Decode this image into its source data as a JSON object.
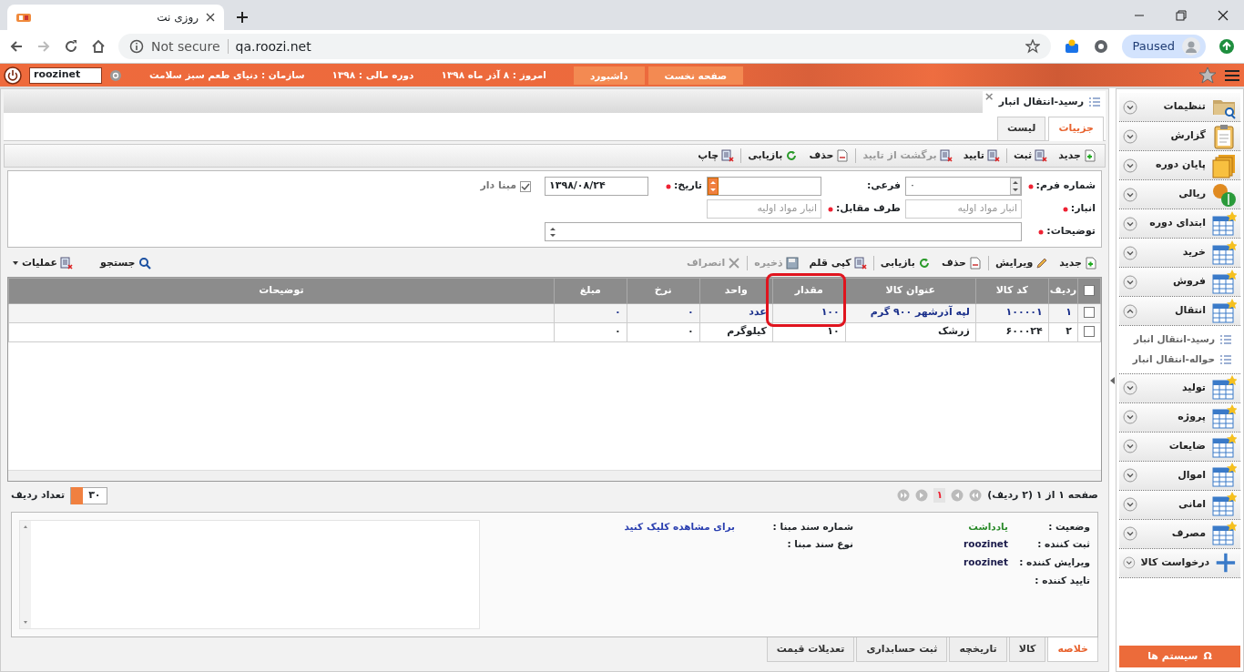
{
  "browser": {
    "tab_title": "روزی نت",
    "security": "Not secure",
    "url": "qa.roozi.net",
    "profile_status": "Paused"
  },
  "header": {
    "user": "roozinet",
    "buttons": [
      "صفحه نخست",
      "داشبورد"
    ],
    "info": [
      {
        "label": "امروز :",
        "value": "۸ آذر ماه ۱۳۹۸"
      },
      {
        "label": "دوره مالی :",
        "value": "۱۳۹۸"
      },
      {
        "label": "سازمان :",
        "value": "دنیای طعم سبز سلامت"
      }
    ]
  },
  "document_tab": {
    "title": "رسید-انتقال انبار",
    "close": "×"
  },
  "view_tabs": [
    {
      "label": "جزییات",
      "selected": true
    },
    {
      "label": "لیست",
      "selected": false
    }
  ],
  "toolbar": [
    {
      "label": "جدید",
      "kind": "new",
      "disabled": false
    },
    {
      "label": "ثبت",
      "kind": "form",
      "disabled": false
    },
    {
      "label": "تایید",
      "kind": "form",
      "disabled": false
    },
    {
      "label": "برگشت از تایید",
      "kind": "form",
      "disabled": true
    },
    {
      "label": "حذف",
      "kind": "delete",
      "disabled": false
    },
    {
      "label": "بازیابی",
      "kind": "refresh",
      "disabled": false
    },
    {
      "label": "چاپ",
      "kind": "form",
      "disabled": false
    }
  ],
  "form": {
    "rows": [
      [
        {
          "label": "شماره فرم:",
          "required": true,
          "kind": "spinner",
          "value": "۰",
          "disabled": false
        },
        {
          "label": "فرعی:",
          "required": false,
          "kind": "select",
          "disabled": false
        },
        {
          "label": "تاریخ:",
          "required": true,
          "kind": "text",
          "value": "۱۳۹۸/۰۸/۲۴",
          "disabled": false
        },
        {
          "label": "مبنا دار",
          "kind": "checkbox",
          "checked": true
        }
      ],
      [
        {
          "label": "انبار:",
          "required": true,
          "kind": "text",
          "value": "انبار مواد اولیه",
          "disabled": true
        },
        {
          "label": "طرف مقابل:",
          "required": true,
          "kind": "text",
          "value": "انبار مواد اولیه",
          "disabled": true
        }
      ],
      [
        {
          "label": "توضیحات:",
          "required": true,
          "kind": "textarea",
          "disabled": false
        }
      ]
    ]
  },
  "grid_toolbar": [
    {
      "label": "جدید",
      "kind": "new",
      "disabled": false
    },
    {
      "label": "ویرایش",
      "kind": "edit",
      "disabled": false
    },
    {
      "label": "حذف",
      "kind": "delete",
      "disabled": false
    },
    {
      "label": "بازیابی",
      "kind": "refresh",
      "disabled": false
    },
    {
      "label": "کپی قلم",
      "kind": "form",
      "disabled": false
    },
    {
      "label": "ذخیره",
      "kind": "save",
      "disabled": true
    },
    {
      "label": "انصراف",
      "kind": "cancel",
      "disabled": true
    }
  ],
  "grid_tools": [
    {
      "label": "جستجو",
      "kind": "search"
    },
    {
      "label": "عملیات",
      "kind": "form"
    }
  ],
  "grid": {
    "columns": [
      {
        "label": "ردیف",
        "highlighted": false
      },
      {
        "label": "کد کالا",
        "highlighted": false
      },
      {
        "label": "عنوان کالا",
        "highlighted": false
      },
      {
        "label": "مقدار",
        "highlighted": true
      },
      {
        "label": "واحد",
        "highlighted": false
      },
      {
        "label": "نرخ",
        "highlighted": false
      },
      {
        "label": "مبلغ",
        "highlighted": false
      },
      {
        "label": "توضیحات",
        "highlighted": false
      }
    ],
    "select_all_checked": false,
    "rows": [
      {
        "selected": true,
        "checked": false,
        "cells": [
          "۱",
          "۱۰۰۰۰۱",
          "لپه آذرشهر ۹۰۰ گرم",
          "۱۰۰",
          "عدد",
          "۰",
          "۰"
        ]
      },
      {
        "selected": false,
        "checked": false,
        "cells": [
          "۲",
          "۶۰۰۰۲۴",
          "زرشک",
          "۱۰",
          "کیلوگرم",
          "۰",
          "۰"
        ]
      }
    ]
  },
  "pager": {
    "summary": "صفحه ۱ از ۱ (۲ ردیف)",
    "page": "۱",
    "rows_per_page": "۳۰",
    "rows_label": "تعداد ردیف"
  },
  "summary": {
    "fields": [
      {
        "label": "وضعیت :",
        "value": "یادداشت",
        "color": "#2a8a2a"
      },
      {
        "label": "ثبت کننده :",
        "value": "roozinet",
        "color": "#1a1a4a"
      },
      {
        "label": "ویرایش کننده :",
        "value": "roozinet",
        "color": "#1a1a4a"
      },
      {
        "label": "تایید کننده :"
      }
    ],
    "source_fields": [
      {
        "label": "شماره سند مبنا :",
        "link": "برای مشاهده کلیک کنید"
      },
      {
        "label": "نوع سند مبنا :"
      }
    ]
  },
  "bottom_tabs": [
    {
      "label": "خلاصه",
      "selected": true
    },
    {
      "label": "کالا",
      "selected": false
    },
    {
      "label": "تاریخچه",
      "selected": false
    },
    {
      "label": "ثبت حسابداری",
      "selected": false
    },
    {
      "label": "تعدیلات قیمت",
      "selected": false
    }
  ],
  "sidebar": {
    "items": [
      {
        "label": "تنظیمات",
        "kind": "folder",
        "expanded": false
      },
      {
        "label": "گزارش",
        "kind": "clipboard",
        "expanded": false
      },
      {
        "label": "پایان دوره",
        "kind": "stack",
        "expanded": false
      },
      {
        "label": "ریالی",
        "kind": "coins",
        "expanded": false
      },
      {
        "label": "ابتدای دوره",
        "kind": "table",
        "expanded": false
      },
      {
        "label": "خرید",
        "kind": "table",
        "expanded": false
      },
      {
        "label": "فروش",
        "kind": "table",
        "expanded": false
      },
      {
        "label": "انتقال",
        "kind": "table",
        "expanded": true,
        "children": [
          {
            "label": "رسید-انتقال انبار"
          },
          {
            "label": "حواله-انتقال انبار"
          }
        ]
      },
      {
        "label": "تولید",
        "kind": "table",
        "expanded": false
      },
      {
        "label": "پروژه",
        "kind": "table",
        "expanded": false
      },
      {
        "label": "ضایعات",
        "kind": "table",
        "expanded": false
      },
      {
        "label": "اموال",
        "kind": "table",
        "expanded": false
      },
      {
        "label": "امانی",
        "kind": "table",
        "expanded": false
      },
      {
        "label": "مصرف",
        "kind": "table",
        "expanded": false
      },
      {
        "label": "درخواست کالا",
        "kind": "plus",
        "expanded": false
      }
    ],
    "footer_button": {
      "symbol": "Ω",
      "label": "سیستم ها"
    }
  }
}
